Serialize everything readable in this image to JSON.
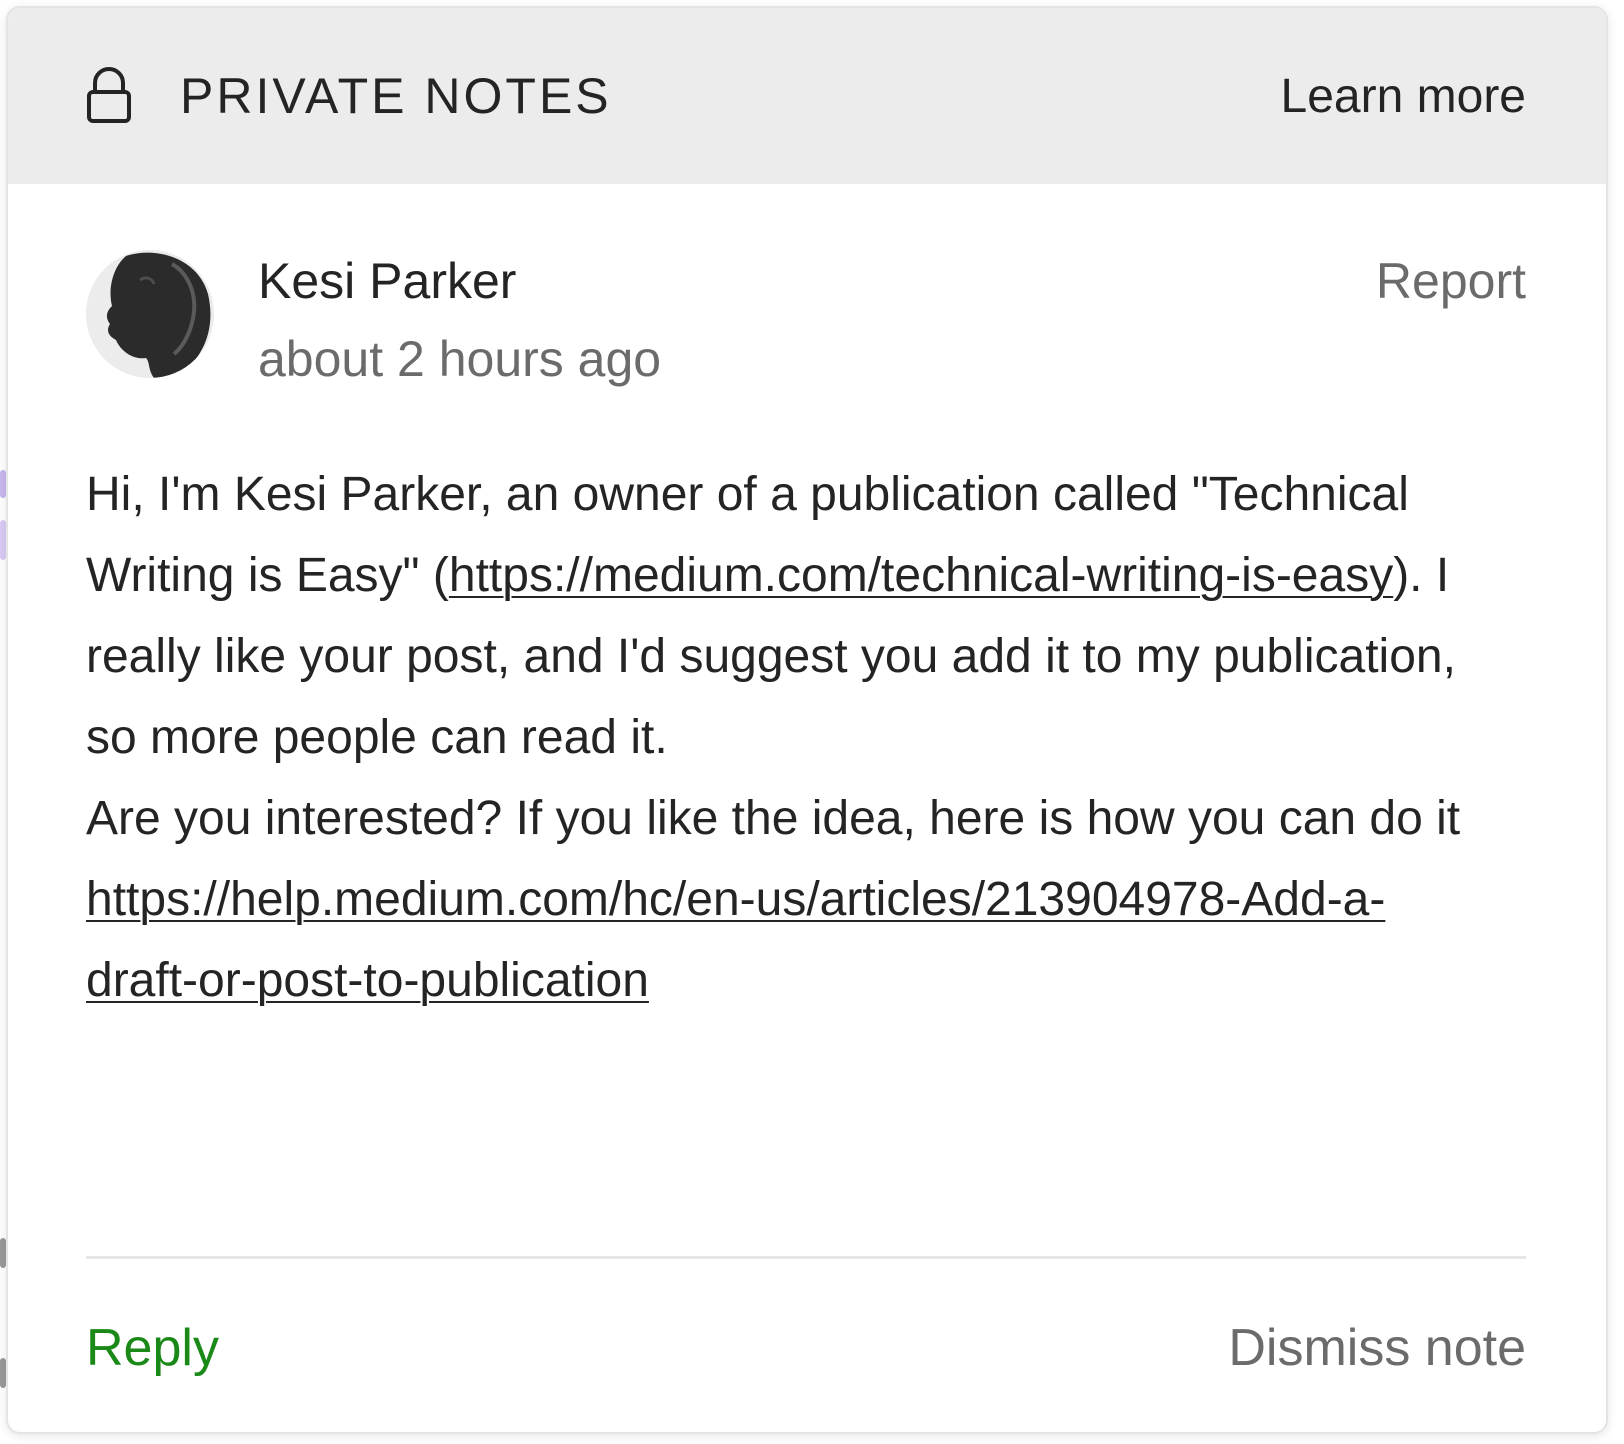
{
  "header": {
    "title": "PRIVATE NOTES",
    "learn_more": "Learn more",
    "icon": "lock-icon"
  },
  "note": {
    "author": "Kesi Parker",
    "timestamp": "about 2 hours ago",
    "report": "Report",
    "body": {
      "part1": "Hi, I'm Kesi Parker, an owner of a publication called \"Technical Writing is Easy\" (",
      "link1": "https://medium.com/technical-writing-is-easy",
      "part2": "). I really like your post, and I'd suggest you add it to my publication, so more people can read it.",
      "part3": "Are you interested? If you like the idea, here is how you can do it ",
      "link2": "https://help.medium.com/hc/en-us/articles/213904978-Add-a-draft-or-post-to-publication"
    }
  },
  "footer": {
    "reply": "Reply",
    "dismiss": "Dismiss note"
  },
  "colors": {
    "reply_green": "#1a8917",
    "muted_gray": "#6b6b6b",
    "header_bg": "#ececec"
  }
}
